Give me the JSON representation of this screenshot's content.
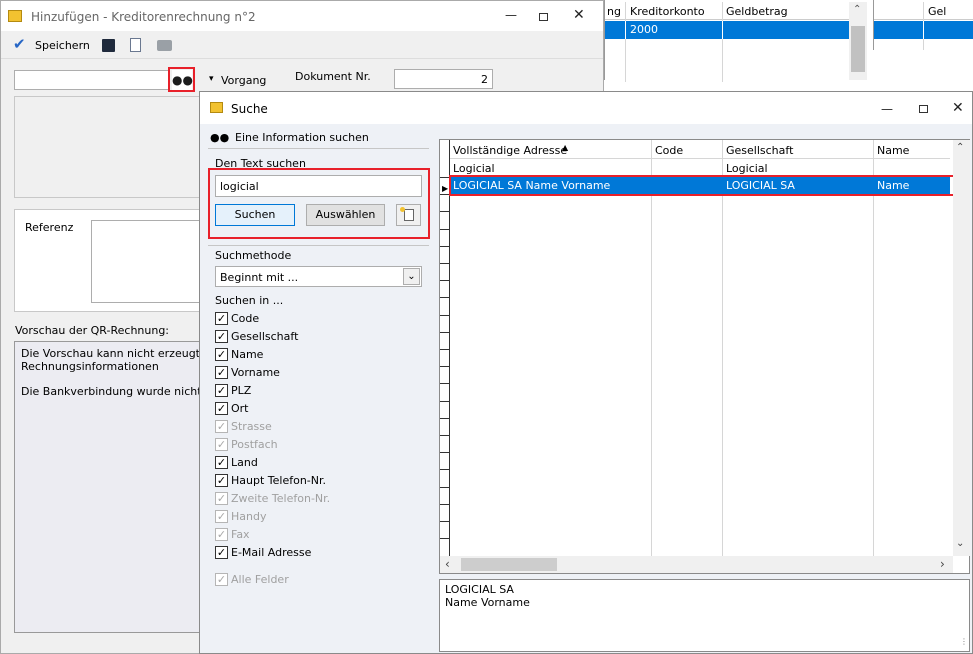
{
  "main_window": {
    "title": "Hinzufügen - Kreditorenrechnung n°2",
    "toolbar": {
      "save_label": "Speichern"
    },
    "vorgang_label": "Vorgang",
    "dokument_label": "Dokument Nr.",
    "dokument_value": "2",
    "referenz_label": "Referenz",
    "qr_label": "Vorschau der QR-Rechnung:",
    "qr_text_1": "Die Vorschau kann nicht erzeugt wer",
    "qr_text_2": "Rechnungsinformationen",
    "qr_text_3": "Die Bankverbindung wurde nicht defi"
  },
  "background_table": {
    "col_partial": "ng",
    "col_kreditorkonto": "Kreditorkonto",
    "col_geldbetrag": "Geldbetrag",
    "row_value": "2000",
    "col_right": "Gel"
  },
  "dialog": {
    "title": "Suche",
    "info_heading": "Eine Information suchen",
    "search_text_label": "Den Text suchen",
    "search_value": "logicial",
    "search_button": "Suchen",
    "select_button": "Auswählen",
    "method_label": "Suchmethode",
    "method_value": "Beginnt mit ...",
    "search_in_label": "Suchen in ...",
    "fields": [
      {
        "label": "Code",
        "checked": true,
        "enabled": true
      },
      {
        "label": "Gesellschaft",
        "checked": true,
        "enabled": true
      },
      {
        "label": "Name",
        "checked": true,
        "enabled": true
      },
      {
        "label": "Vorname",
        "checked": true,
        "enabled": true
      },
      {
        "label": "PLZ",
        "checked": true,
        "enabled": true
      },
      {
        "label": "Ort",
        "checked": true,
        "enabled": true
      },
      {
        "label": "Strasse",
        "checked": true,
        "enabled": false
      },
      {
        "label": "Postfach",
        "checked": true,
        "enabled": false
      },
      {
        "label": "Land",
        "checked": true,
        "enabled": true
      },
      {
        "label": "Haupt Telefon-Nr.",
        "checked": true,
        "enabled": true
      },
      {
        "label": "Zweite Telefon-Nr.",
        "checked": true,
        "enabled": false
      },
      {
        "label": "Handy",
        "checked": true,
        "enabled": false
      },
      {
        "label": "Fax",
        "checked": true,
        "enabled": false
      },
      {
        "label": "E-Mail Adresse",
        "checked": true,
        "enabled": true
      }
    ],
    "all_fields_label": "Alle Felder",
    "grid": {
      "columns": [
        "Vollständige Adresse",
        "Code",
        "Gesellschaft",
        "Name"
      ],
      "rows": [
        [
          "Logicial",
          "",
          "Logicial",
          ""
        ],
        [
          "LOGICIAL SA Name Vorname",
          "",
          "LOGICIAL SA",
          "Name"
        ]
      ],
      "selected_row": 1
    },
    "preview_line_1": "LOGICIAL SA",
    "preview_line_2": "Name Vorname"
  },
  "colors": {
    "selection": "#0078d7",
    "highlight_border": "#e8202a",
    "dialog_bg": "#eef1f6"
  }
}
